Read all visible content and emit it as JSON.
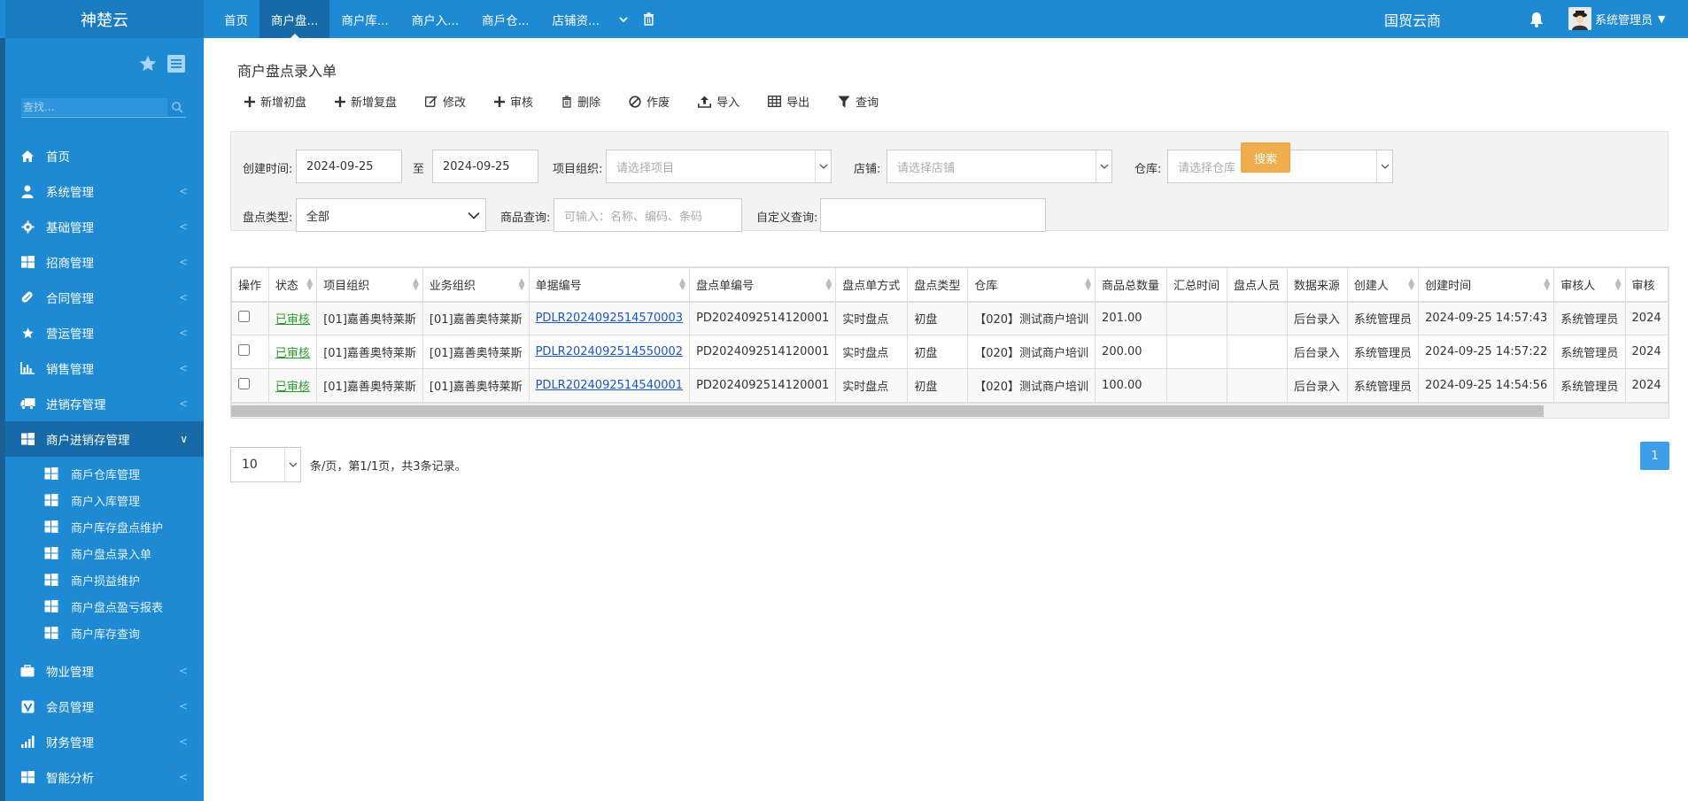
{
  "brand": "神楚云",
  "topnav": {
    "tabs": [
      "首页",
      "商户盘...",
      "商户库...",
      "商户入...",
      "商戶仓...",
      "店铺资..."
    ],
    "active_index": 1
  },
  "company": "国贸云商",
  "user": {
    "name": "系统管理员"
  },
  "sidebar": {
    "search_placeholder": "查找...",
    "items": [
      {
        "label": "首页",
        "icon": "home-icon"
      },
      {
        "label": "系统管理",
        "icon": "user-icon"
      },
      {
        "label": "基础管理",
        "icon": "gear-icon"
      },
      {
        "label": "招商管理",
        "icon": "windows-icon"
      },
      {
        "label": "合同管理",
        "icon": "pill-icon"
      },
      {
        "label": "营运管理",
        "icon": "star-icon"
      },
      {
        "label": "销售管理",
        "icon": "chart-icon"
      },
      {
        "label": "进销存管理",
        "icon": "truck-icon"
      },
      {
        "label": "商户进销存管理",
        "icon": "windows-icon"
      }
    ],
    "sub_items": [
      "商戶仓库管理",
      "商户入库管理",
      "商户库存盘点维护",
      "商户盘点录入单",
      "商户损益维护",
      "商户盘点盈亏报表",
      "商户库存查询"
    ],
    "items_after": [
      {
        "label": "物业管理",
        "icon": "briefcase-icon"
      },
      {
        "label": "会员管理",
        "icon": "vip-icon"
      },
      {
        "label": "财务管理",
        "icon": "signal-icon"
      },
      {
        "label": "智能分析",
        "icon": "windows-icon"
      }
    ]
  },
  "page": {
    "title": "商户盘点录入单",
    "toolbar": [
      "新增初盘",
      "新增复盘",
      "修改",
      "审核",
      "删除",
      "作废",
      "导入",
      "导出",
      "查询"
    ]
  },
  "filter": {
    "created_label": "创建时间:",
    "date_from": "2024-09-25",
    "to_label": "至",
    "date_to": "2024-09-25",
    "project_label": "项目组织:",
    "project_placeholder": "请选择项目",
    "shop_label": "店铺:",
    "shop_placeholder": "请选择店铺",
    "warehouse_label": "仓库:",
    "warehouse_placeholder": "请选择仓库",
    "type_label": "盘点类型:",
    "type_value": "全部",
    "goods_label": "商品查询:",
    "goods_placeholder": "可输入：名称、编码、条码",
    "custom_label": "自定义查询:",
    "search_button": "搜索"
  },
  "table": {
    "headers": [
      "操作",
      "状态",
      "项目组织",
      "业务组织",
      "单据编号",
      "盘点单编号",
      "盘点单方式",
      "盘点类型",
      "仓库",
      "商品总数量",
      "汇总时间",
      "盘点人员",
      "数据来源",
      "创建人",
      "创建时间",
      "审核人",
      "审核"
    ],
    "rows": [
      [
        "",
        "已审核",
        "[01]嘉善奥特莱斯",
        "[01]嘉善奥特莱斯",
        "PDLR2024092514570003",
        "PD2024092514120001",
        "实时盘点",
        "初盘",
        "【020】测试商户培训",
        "201.00",
        "",
        "",
        "后台录入",
        "系统管理员",
        "2024-09-25 14:57:43",
        "系统管理员",
        "2024"
      ],
      [
        "",
        "已审核",
        "[01]嘉善奥特莱斯",
        "[01]嘉善奥特莱斯",
        "PDLR2024092514550002",
        "PD2024092514120001",
        "实时盘点",
        "初盘",
        "【020】测试商户培训",
        "200.00",
        "",
        "",
        "后台录入",
        "系统管理员",
        "2024-09-25 14:57:22",
        "系统管理员",
        "2024"
      ],
      [
        "",
        "已审核",
        "[01]嘉善奥特莱斯",
        "[01]嘉善奥特莱斯",
        "PDLR2024092514540001",
        "PD2024092514120001",
        "实时盘点",
        "初盘",
        "【020】测试商户培训",
        "100.00",
        "",
        "",
        "后台录入",
        "系统管理员",
        "2024-09-25 14:54:56",
        "系统管理员",
        "2024"
      ]
    ]
  },
  "pager": {
    "page_size": "10",
    "text": "条/页，第1/1页，共3条记录。",
    "current_page": "1"
  }
}
